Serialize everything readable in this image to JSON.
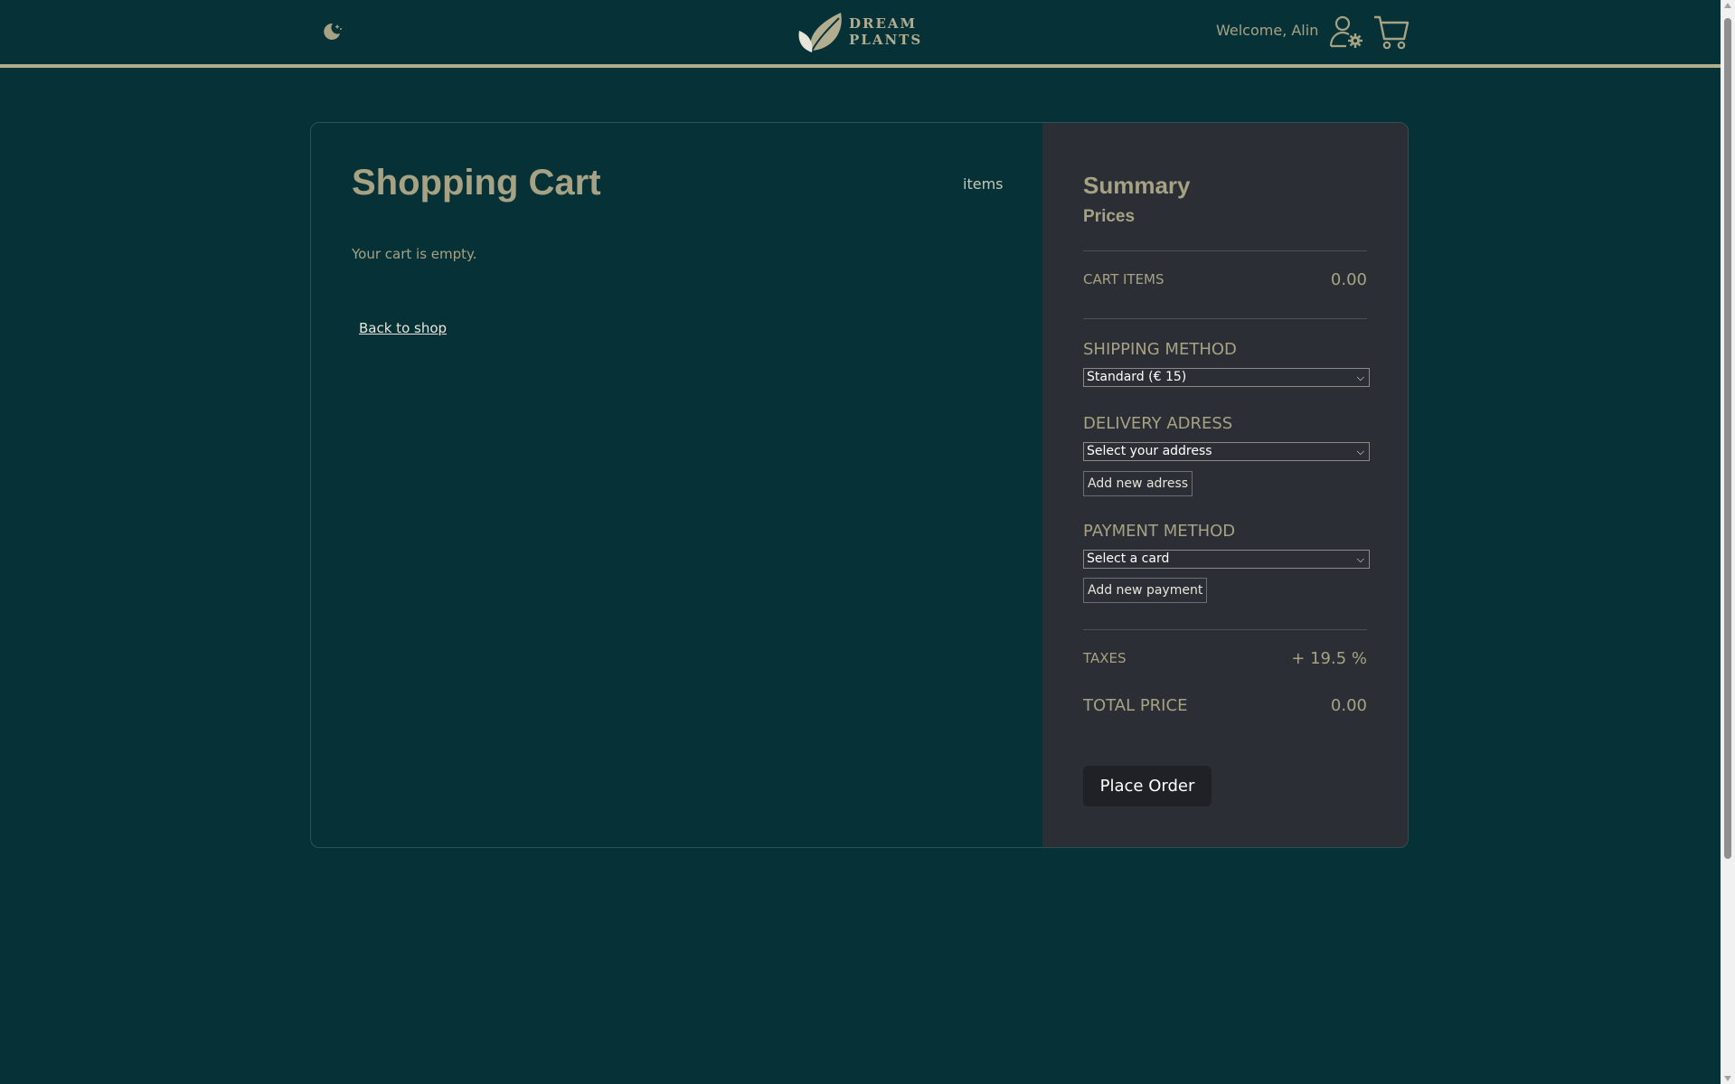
{
  "header": {
    "logo_line1": "DREAM",
    "logo_line2": "PLANTS",
    "welcome": "Welcome, Alin",
    "icons": [
      "moon-stars-icon",
      "leaf-logo-icon",
      "user-settings-icon",
      "shopping-cart-icon"
    ]
  },
  "cart": {
    "title": "Shopping Cart",
    "items_label": "items",
    "empty_message": "Your cart is empty.",
    "back_link": "Back to shop"
  },
  "summary": {
    "title": "Summary",
    "subtitle": "Prices",
    "cart_items_label": "CART ITEMS",
    "cart_items_value": "0.00",
    "shipping_label": "SHIPPING METHOD",
    "shipping_selected": "Standard (€ 15)",
    "delivery_label": "DELIVERY ADRESS",
    "delivery_selected": "Select your address",
    "add_address": "Add new adress",
    "payment_label": "PAYMENT METHOD",
    "payment_selected": "Select a card",
    "add_payment": "Add new payment",
    "taxes_label": "TAXES",
    "taxes_value": "+ 19.5 %",
    "total_label": "TOTAL PRICE",
    "total_value": "0.00",
    "place_order": "Place Order"
  },
  "colors": {
    "background": "#063237",
    "accent": "#a6a283",
    "summary_panel": "#2c2e35",
    "button_dark": "#1f2126"
  }
}
